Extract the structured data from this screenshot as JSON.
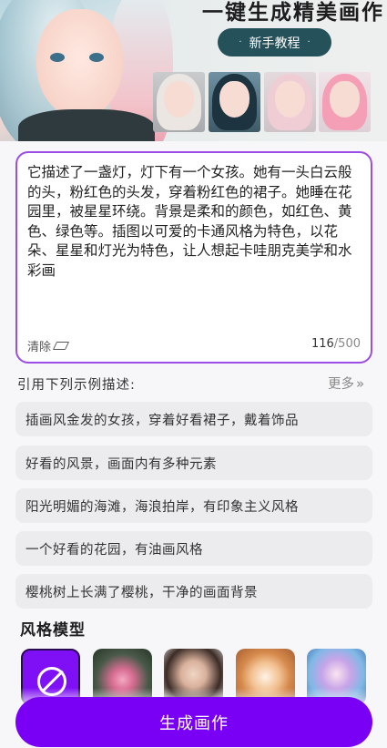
{
  "banner": {
    "title": "一键生成精美画作",
    "tutorial_label": "新手教程",
    "tutorial_dot": "·",
    "thumbnails": [
      {
        "name": "white-hair-girl",
        "hair": "#e6e0dc",
        "bg": "#b7b8bb"
      },
      {
        "name": "dark-hair-girl",
        "hair": "#1f3946",
        "bg": "#5d7e8f"
      },
      {
        "name": "pink-white-hair-girl",
        "hair": "#efc5cf",
        "bg": "#d9cdd2"
      },
      {
        "name": "pink-hair-girl",
        "hair": "#f49db5",
        "bg": "#e7d9de"
      }
    ]
  },
  "prompt": {
    "text": "它描述了一盏灯，灯下有一个女孩。她有一头白云般的头，粉红色的头发，穿着粉红色的裙子。她睡在花园里，被星星环绕。背景是柔和的颜色，如红色、黄色、绿色等。插图以可爱的卡通风格为特色，以花朵、星星和灯光为特色，让人想起卡哇朋克美学和水彩画",
    "clear_label": "清除",
    "count": "116",
    "max": "/500"
  },
  "examples": {
    "header": "引用下列示例描述:",
    "more_label": "更多",
    "more_chevron": "»",
    "items": [
      "插画风金发的女孩，穿着好看裙子，戴着饰品",
      "好看的风景，画面内有多种元素",
      "阳光明媚的海滩，海浪拍岸，有印象主义风格",
      "一个好看的花园，有油画风格",
      "樱桃树上长满了樱桃，干净的画面背景"
    ]
  },
  "styles": {
    "title": "风格模型",
    "models": [
      {
        "name": "none",
        "selected": true
      },
      {
        "name": "lotus-flower"
      },
      {
        "name": "realistic-woman"
      },
      {
        "name": "hamster"
      },
      {
        "name": "fantasy-elf"
      }
    ]
  },
  "generate_label": "生成画作",
  "colors": {
    "accent": "#7a00f5",
    "card_border": "#9b4de6",
    "tutorial_bg": "#25515a"
  }
}
